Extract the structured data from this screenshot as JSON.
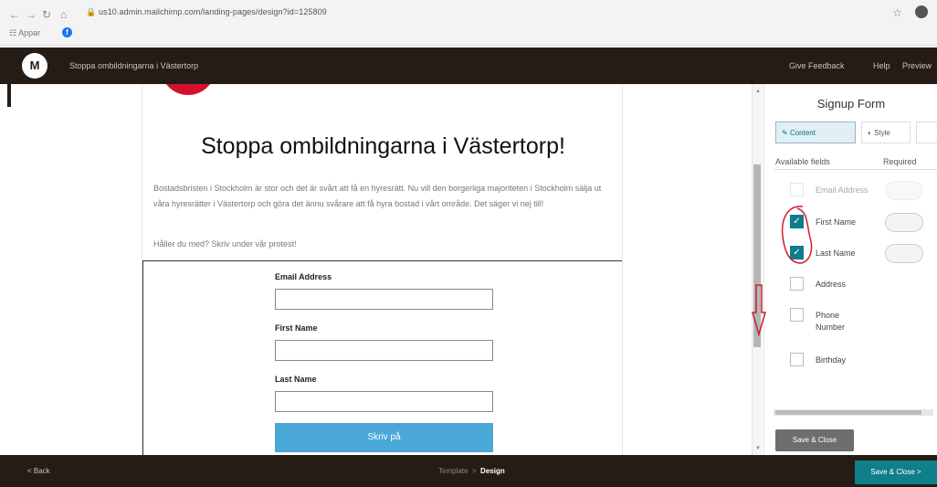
{
  "browser": {
    "url": "us10.admin.mailchimp.com/landing-pages/design?id=125809",
    "bookmarks_label": "Appar"
  },
  "topbar": {
    "logo_text": "M",
    "breadcrumb": "Stoppa ombildningarna i Västertorp",
    "links": [
      "Give Feedback",
      "Help",
      "Preview"
    ]
  },
  "page": {
    "headline": "Stoppa ombildningarna i Västertorp!",
    "body": "Bostadsbristen i Stockholm är stor och det är svårt att få en hyresrätt. Nu vill den borgerliga majoriteten i Stockholm sälja ut våra hyresrätter i Västertorp och göra det ännu svårare att få hyra bostad i vårt område. Det säger vi nej till!",
    "question": "Håller du med? Skriv under vår protest!",
    "form": {
      "fields": [
        {
          "label": "Email Address"
        },
        {
          "label": "First Name"
        },
        {
          "label": "Last Name"
        }
      ],
      "submit_label": "Skriv på"
    }
  },
  "panel": {
    "title": "Signup Form",
    "tabs": [
      "Content",
      "Style",
      ""
    ],
    "col_available": "Available fields",
    "col_required": "Required",
    "fields": [
      {
        "name": "Email Address",
        "checked": false,
        "disabled": true
      },
      {
        "name": "First Name",
        "checked": true,
        "disabled": false
      },
      {
        "name": "Last Name",
        "checked": true,
        "disabled": false
      },
      {
        "name": "Address",
        "checked": false,
        "disabled": false
      },
      {
        "name": "Phone Number",
        "checked": false,
        "disabled": false
      },
      {
        "name": "Birthday",
        "checked": false,
        "disabled": false
      }
    ],
    "save_label": "Save & Close"
  },
  "bottombar": {
    "back_label": "< Back",
    "step_template": "Template",
    "step_separator": ">",
    "step_design": "Design",
    "save_label": "Save & Close >"
  },
  "colors": {
    "chrome_dark": "#241c15",
    "accent_teal": "#0f7f8a",
    "submit_blue": "#4aa8d8",
    "annotation_red": "#cc1f2f"
  }
}
